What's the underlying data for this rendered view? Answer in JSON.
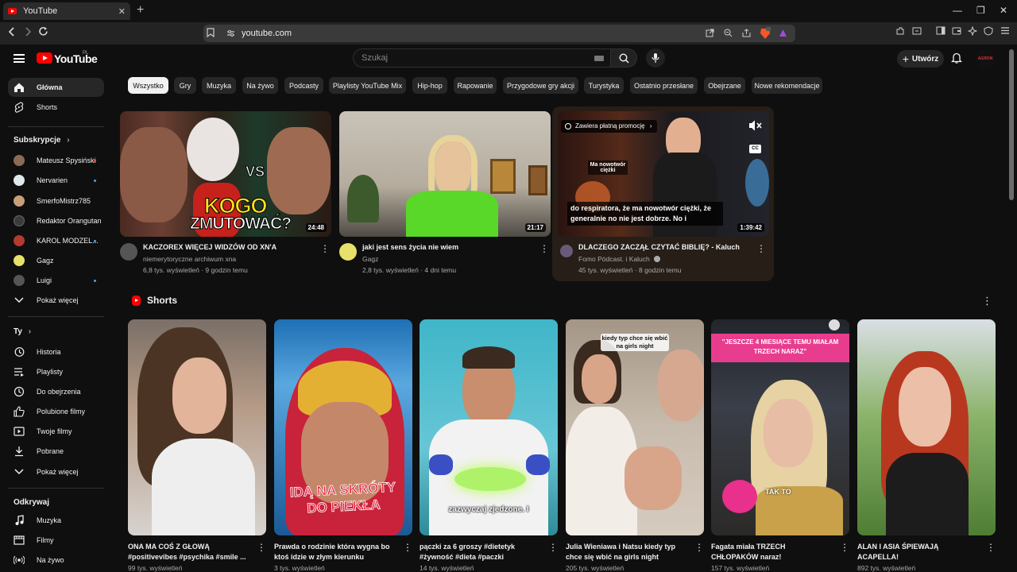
{
  "browser": {
    "tab_title": "YouTube",
    "tab_close": "✕",
    "new_tab": "+",
    "url": "youtube.com",
    "window_min": "—",
    "window_max": "❐",
    "window_close": "✕"
  },
  "masthead": {
    "logo_text": "YouTube",
    "country": "PL",
    "search_placeholder": "Szukaj",
    "create_label": "Utwórz",
    "avatar_text": "AGRON"
  },
  "sidebar": {
    "main": [
      {
        "label": "Główna",
        "icon": "home-icon",
        "active": true
      },
      {
        "label": "Shorts",
        "icon": "shorts-icon",
        "active": false
      }
    ],
    "subs_heading": "Subskrypcje",
    "subs": [
      {
        "label": "Mateusz Spysiński",
        "color": "#8a6b55",
        "dot": true
      },
      {
        "label": "Nervarien",
        "color": "#dfe8ea",
        "dot": true
      },
      {
        "label": "SmerfoMistrz785",
        "color": "#c7a07a",
        "dot": false
      },
      {
        "label": "Redaktor Orangutan",
        "color": "#3b3b3b",
        "dot": false
      },
      {
        "label": "KAROL MODZEL...",
        "color": "#b33a2e",
        "dot": true
      },
      {
        "label": "Gagz",
        "color": "#e7e06a",
        "dot": false
      },
      {
        "label": "Luigi",
        "color": "#555555",
        "dot": true
      }
    ],
    "subs_more": "Pokaż więcej",
    "you_heading": "Ty",
    "you": [
      {
        "label": "Historia",
        "icon": "history-icon"
      },
      {
        "label": "Playlisty",
        "icon": "playlists-icon"
      },
      {
        "label": "Do obejrzenia",
        "icon": "watch-later-icon"
      },
      {
        "label": "Polubione filmy",
        "icon": "thumbs-up-icon"
      },
      {
        "label": "Twoje filmy",
        "icon": "your-videos-icon"
      },
      {
        "label": "Pobrane",
        "icon": "download-icon"
      }
    ],
    "you_more": "Pokaż więcej",
    "explore_heading": "Odkrywaj",
    "explore": [
      {
        "label": "Muzyka",
        "icon": "music-icon"
      },
      {
        "label": "Filmy",
        "icon": "film-icon"
      },
      {
        "label": "Na żywo",
        "icon": "live-icon"
      }
    ]
  },
  "chips": [
    "Wszystko",
    "Gry",
    "Muzyka",
    "Na żywo",
    "Podcasty",
    "Playlisty YouTube Mix",
    "Hip-hop",
    "Rapowanie",
    "Przygodowe gry akcji",
    "Turystyka",
    "Ostatnio przesłane",
    "Obejrzane",
    "Nowe rekomendacje"
  ],
  "videos": [
    {
      "title": "KACZOREX WIĘCEJ WIDZÓW OD XN'A",
      "channel": "niemerytoryczne archiwum xna",
      "meta": "6,8 tys. wyświetleń · 9 godzin temu",
      "duration": "24:48",
      "overlay_big": "KOGO",
      "overlay_big2": "ZMUTOWAĆ?",
      "overlay_vs": "VS"
    },
    {
      "title": "jaki jest sens życia nie wiem",
      "channel": "Gagz",
      "meta": "2,8 tys. wyświetleń · 4 dni temu",
      "duration": "21:17"
    },
    {
      "title": "DLACZEGO ZACZĄŁ CZYTAĆ BIBLIĘ? - Kaluch",
      "channel": "Fomo Pódcast. i Kaluch",
      "meta": "45 tys. wyświetleń · 8 godzin temu",
      "duration": "1:39:42",
      "promo": "Zawiera płatną promocję",
      "cc": "CC",
      "sign": "Ma nowotwór ciężki",
      "caption": "do respiratora, że ma nowotwór ciężki, że generalnie no nie jest dobrze. No i"
    }
  ],
  "shorts_heading": "Shorts",
  "shorts": [
    {
      "title": "ONA MA COŚ Z GŁOWĄ #positivevibes #psychika #smile ...",
      "views": "99 tys. wyświetleń"
    },
    {
      "title": "Prawda o rodzinie która wygna bo ktoś idzie w złym kierunku",
      "views": "3 tys. wyświetleń",
      "overlay": "IDĄ NA SKRÓTY DO PIEKŁA"
    },
    {
      "title": "pączki za 6 groszy #dietetyk #żywność #dieta #paczki",
      "views": "14 tys. wyświetleń",
      "overlay": "zazwyczaj zjedzone. I"
    },
    {
      "title": "Julia Wieniawa i Natsu kiedy typ chce się wbić na girls night",
      "views": "205 tys. wyświetleń",
      "overlay": "kiedy typ chce się wbić na girls night"
    },
    {
      "title": "Fagata miała TRZECH CHŁOPAKÓW naraz!",
      "views": "157 tys. wyświetleń",
      "overlay": "\"JESZCZE 4 MIESIĄCE TEMU MIAŁAM TRZECH NARAZ\"",
      "mic_text": "TAK TO"
    },
    {
      "title": "ALAN I ASIA ŚPIEWAJĄ ACAPELLA!",
      "views": "892 tys. wyświetleń"
    }
  ]
}
